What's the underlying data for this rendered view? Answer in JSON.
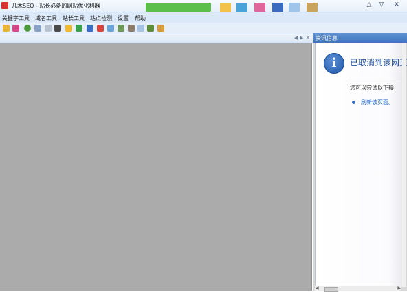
{
  "window": {
    "title": "几木SEO - 站长必备的网站优化利器",
    "controls": {
      "minimize": "△",
      "maximize": "▽",
      "close": "✕"
    }
  },
  "menu": {
    "items": [
      "关键字工具",
      "域名工具",
      "站长工具",
      "站点检测",
      "设置",
      "帮助"
    ]
  },
  "toolbar": {
    "icons": [
      "key-icon",
      "chart-icon",
      "globe-icon",
      "search-icon",
      "page-icon",
      "binoculars-icon",
      "bolt-icon",
      "refresh-icon",
      "image-icon",
      "flags-icon",
      "upload-icon",
      "cloud-icon",
      "link-icon",
      "document-icon",
      "bug-icon",
      "user-icon"
    ]
  },
  "info_panel": {
    "header": "资讯信息",
    "error_title": "已取消到该网页",
    "suggestion": "您可以尝试以下操",
    "link": "刷新该页面。"
  },
  "colors": {
    "content_bg": "#ababab",
    "header_blue": "#3f74be",
    "link": "#1d5fc0"
  }
}
